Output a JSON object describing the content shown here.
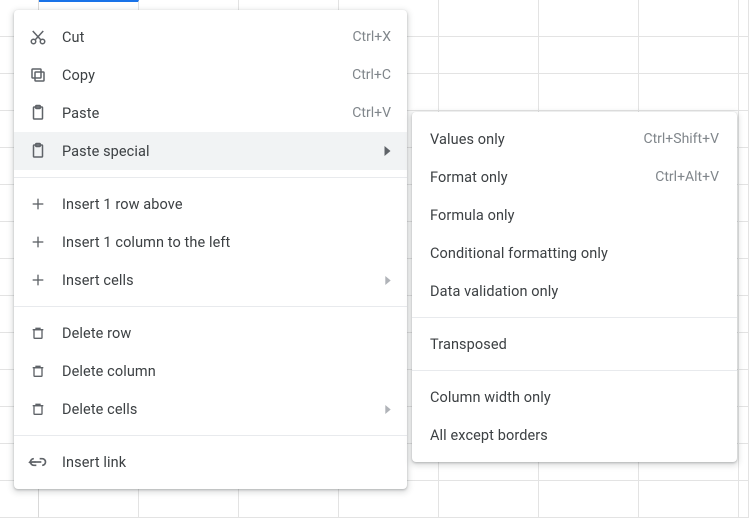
{
  "main_menu": {
    "cut": {
      "label": "Cut",
      "shortcut": "Ctrl+X"
    },
    "copy": {
      "label": "Copy",
      "shortcut": "Ctrl+C"
    },
    "paste": {
      "label": "Paste",
      "shortcut": "Ctrl+V"
    },
    "paste_special": {
      "label": "Paste special"
    },
    "insert_row": {
      "label": "Insert 1 row above"
    },
    "insert_col": {
      "label": "Insert 1 column to the left"
    },
    "insert_cells": {
      "label": "Insert cells"
    },
    "delete_row": {
      "label": "Delete row"
    },
    "delete_col": {
      "label": "Delete column"
    },
    "delete_cells": {
      "label": "Delete cells"
    },
    "insert_link": {
      "label": "Insert link"
    }
  },
  "submenu": {
    "values_only": {
      "label": "Values only",
      "shortcut": "Ctrl+Shift+V"
    },
    "format_only": {
      "label": "Format only",
      "shortcut": "Ctrl+Alt+V"
    },
    "formula_only": {
      "label": "Formula only"
    },
    "cond_fmt_only": {
      "label": "Conditional formatting only"
    },
    "data_val_only": {
      "label": "Data validation only"
    },
    "transposed": {
      "label": "Transposed"
    },
    "col_width_only": {
      "label": "Column width only"
    },
    "all_except_bord": {
      "label": "All except borders"
    }
  }
}
